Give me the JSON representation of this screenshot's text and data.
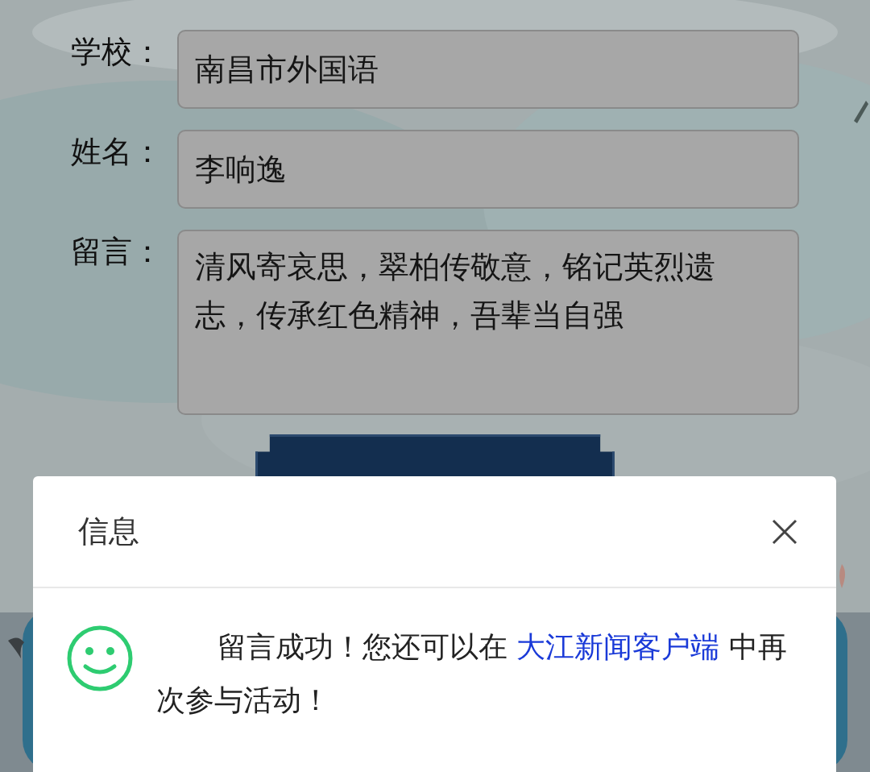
{
  "form": {
    "fields": [
      {
        "label": "学校：",
        "value": "南昌市外国语",
        "kind": "input"
      },
      {
        "label": "姓名：",
        "value": "李响逸",
        "kind": "input"
      },
      {
        "label": "留言：",
        "value": "清风寄哀思，翠柏传敬意，铭记英烈遗志，传承红色精神，吾辈当自强",
        "kind": "textarea"
      }
    ]
  },
  "dialog": {
    "title": "信息",
    "message": "留言成功！您还可以在 ",
    "link": "大江新闻客户端",
    "message_end": " 中再次参与活动！"
  }
}
